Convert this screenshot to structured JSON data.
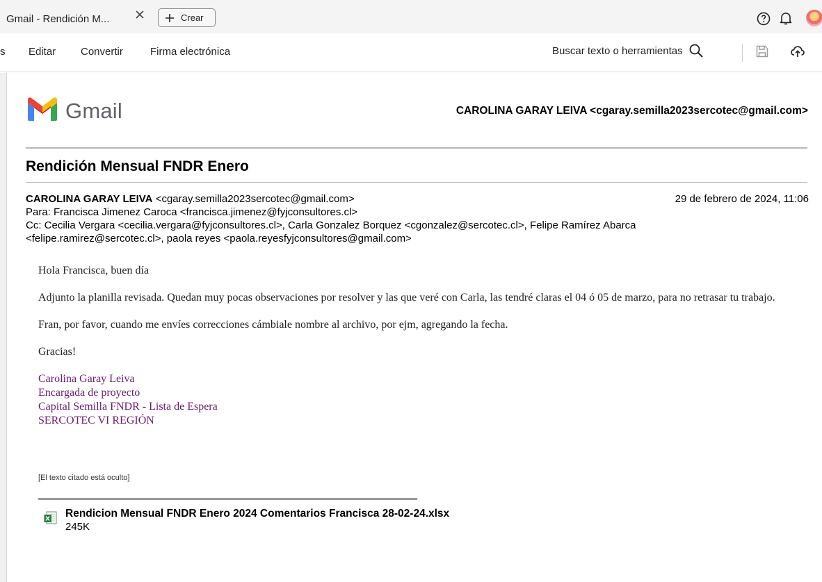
{
  "tab": {
    "title": "Gmail - Rendición M...",
    "create_label": "Crear"
  },
  "toolbar": {
    "partial_item": "s",
    "items": [
      "Editar",
      "Convertir",
      "Firma electrónica"
    ],
    "search_label": "Buscar texto o herramientas"
  },
  "header": {
    "logo_text": "Gmail",
    "sender_full": "CAROLINA GARAY LEIVA <cgaray.semilla2023sercotec@gmail.com>"
  },
  "email": {
    "subject": "Rendición Mensual FNDR Enero",
    "from_name": "CAROLINA GARAY LEIVA",
    "from_email": "<cgaray.semilla2023sercotec@gmail.com>",
    "date": "29 de febrero de 2024, 11:06",
    "to_line": "Para: Francisca Jimenez Caroca <francisca.jimenez@fyjconsultores.cl>",
    "cc_line": "Cc: Cecilia Vergara <cecilia.vergara@fyjconsultores.cl>, Carla Gonzalez Borquez <cgonzalez@sercotec.cl>, Felipe Ramírez Abarca <felipe.ramirez@sercotec.cl>, paola reyes <paola.reyesfyjconsultores@gmail.com>",
    "greeting": "Hola Francisca, buen día",
    "paragraph1": "Adjunto la planilla revisada. Quedan muy pocas observaciones por resolver y las que veré con Carla, las tendré claras el 04 ó 05 de marzo, para no retrasar tu trabajo.",
    "paragraph2": "Fran, por favor, cuando me envíes correcciones cámbiale nombre al archivo, por ejm, agregando la fecha.",
    "thanks": "Gracias!",
    "signature": [
      "Carolina Garay Leiva",
      "Encargada de proyecto",
      "Capital Semilla FNDR - Lista de Espera",
      "SERCOTEC VI REGIÓN"
    ],
    "quoted_hidden": "[El texto citado está oculto]",
    "attachment": {
      "name": "Rendicion Mensual FNDR Enero 2024 Comentarios Francisca 28-02-24.xlsx",
      "size": "245K"
    }
  },
  "colors": {
    "signature": "#6b1d6b",
    "gmail_red": "#ea4335",
    "gmail_blue": "#4285f4",
    "gmail_green": "#34a853",
    "gmail_yellow": "#fbbc04"
  }
}
